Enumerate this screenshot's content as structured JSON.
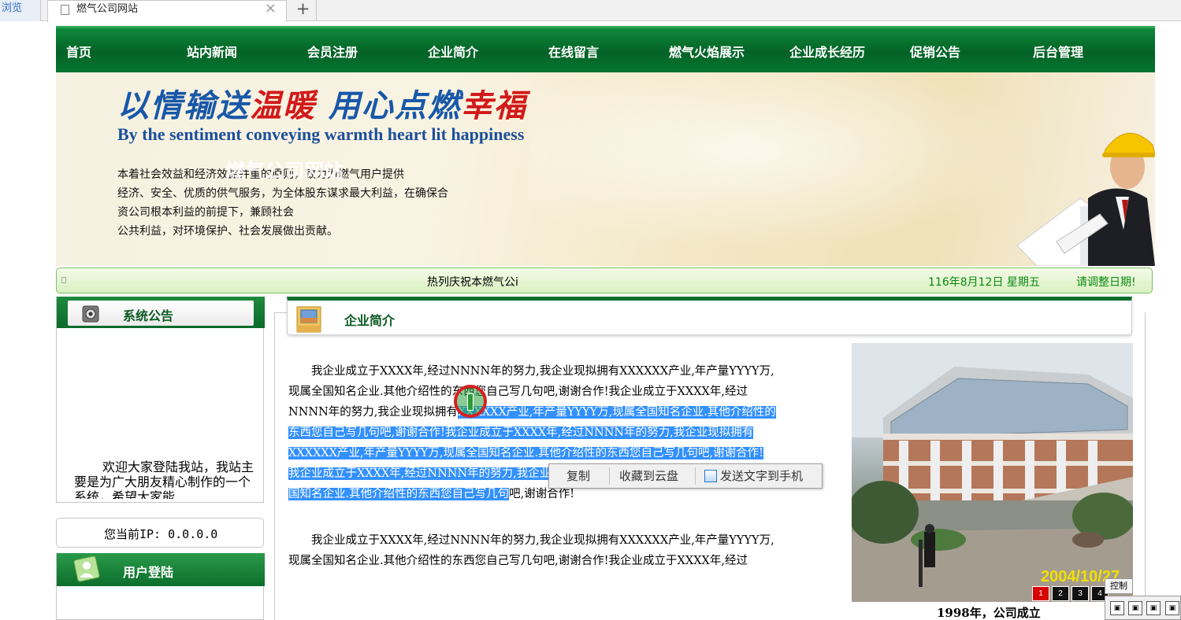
{
  "browser": {
    "left_tab_label": "浏览",
    "active_tab_title": "燃气公司网站",
    "close_glyph": "×",
    "new_tab_glyph": "+"
  },
  "nav": {
    "items": [
      {
        "label": "首页"
      },
      {
        "label": "站内新闻"
      },
      {
        "label": "会员注册"
      },
      {
        "label": "企业简介"
      },
      {
        "label": "在线留言"
      },
      {
        "label": "燃气火焰展示"
      },
      {
        "label": "企业成长经历"
      },
      {
        "label": "促销公告"
      },
      {
        "label": "后台管理"
      }
    ]
  },
  "banner": {
    "slogan_part1": "以情输送",
    "slogan_part2": "温暖",
    "slogan_part3": " 用心点燃",
    "slogan_part4": "幸福",
    "slogan_en": "By the sentiment conveying warmth heart lit happiness",
    "ghost_title": "燃气公司网站",
    "description_lines": [
      "本着社会效益和经济效益并重的原则，致力为燃气用户提供",
      "经济、安全、优质的供气服务，为全体股东谋求最大利益，在确保合",
      "资公司根本利益的前提下，兼顾社会",
      "公共利益，对环境保护、社会发展做出贡献。"
    ]
  },
  "marquee": {
    "text": "热列庆祝本燃气公i",
    "date": "116年8月12日 星期五",
    "adjust": "请调整日期!"
  },
  "sidebar": {
    "announcement_title": "系统公告",
    "announcement_body": "欢迎大家登陆我站，我站主要是为广大朋友精心制作的一个系统，希望大家能",
    "ip_text": "您当前IP: 0.0.0.0",
    "login_title": "用户登陆"
  },
  "main": {
    "title": "企业简介",
    "paragraph1_lines": [
      {
        "plain_before": "　　我企业成立于XXXX年,经过NNNN年的努力,我企业现拟拥有XXXXXX产业,年产量YYYY万,",
        "highlight": "",
        "plain_after": ""
      },
      {
        "plain_before": "现属全国知名企业.其他介绍性的东西您自己写几句吧,谢谢合作!我企业成立于XXXX年,经过",
        "highlight": "",
        "plain_after": ""
      },
      {
        "plain_before": "NNNN年的努力,我企业现拟拥有",
        "highlight": "XXXXXX产业,年产量YYYY万,现属全国知名企业.其他介绍性的",
        "plain_after": ""
      },
      {
        "plain_before": "",
        "highlight": "东西您自己写几句吧,谢谢合作!我企业成立于XXXX年,经过NNNN年的努力,我企业现拟拥有",
        "plain_after": ""
      },
      {
        "plain_before": "",
        "highlight": "XXXXXX产业,年产量YYYY万,现属全国知名企业.其他介绍性的东西您自己写几句吧,谢谢合作!",
        "plain_after": ""
      },
      {
        "plain_before": "",
        "highlight": "我企业成立于XXXX年,经过NNNN年的努力,我企业现拟拥有XXXXXX产业,年产量YYYY万,现属全",
        "plain_after": ""
      },
      {
        "plain_before": "",
        "highlight": "国知名企业.其他介绍性的东西您自己写几句",
        "plain_after": "吧,谢谢合作!"
      }
    ],
    "paragraph2_lines": [
      "　　我企业成立于XXXX年,经过NNNN年的努力,我企业现拟拥有XXXXXX产业,年产量YYYY万,",
      "现属全国知名企业.其他介绍性的东西您自己写几句吧,谢谢合作!我企业成立于XXXX年,经过"
    ]
  },
  "context_menu": {
    "copy": "复制",
    "save_cloud": "收藏到云盘",
    "send_phone": "发送文字到手机"
  },
  "photo": {
    "date_stamp": "2004/10/27",
    "pager": [
      "1",
      "2",
      "3",
      "4"
    ],
    "active_page": "1",
    "caption": "1998年，公司成立"
  },
  "control_widget": {
    "label": "控制",
    "buttons": [
      "▣",
      "▣",
      "▣",
      "▣"
    ]
  }
}
